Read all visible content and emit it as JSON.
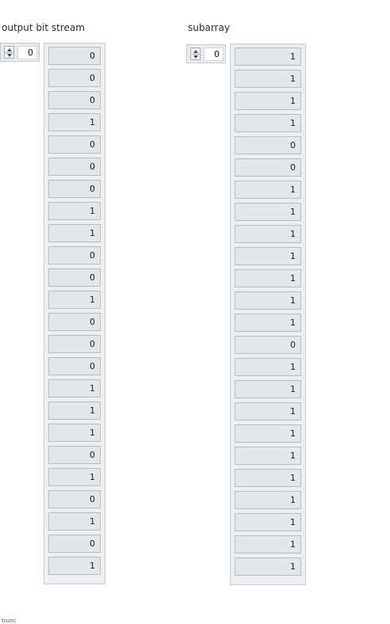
{
  "arrays": [
    {
      "label": "output bit stream",
      "index_value": "0",
      "values": [
        "0",
        "0",
        "0",
        "1",
        "0",
        "0",
        "0",
        "1",
        "1",
        "0",
        "0",
        "1",
        "0",
        "0",
        "0",
        "1",
        "1",
        "1",
        "0",
        "1",
        "0",
        "1",
        "0",
        "1"
      ]
    },
    {
      "label": "subarray",
      "index_value": "0",
      "values": [
        "1",
        "1",
        "1",
        "1",
        "0",
        "0",
        "1",
        "1",
        "1",
        "1",
        "1",
        "1",
        "1",
        "0",
        "1",
        "1",
        "1",
        "1",
        "1",
        "1",
        "1",
        "1",
        "1",
        "1"
      ]
    }
  ],
  "footer_text": "trunc"
}
